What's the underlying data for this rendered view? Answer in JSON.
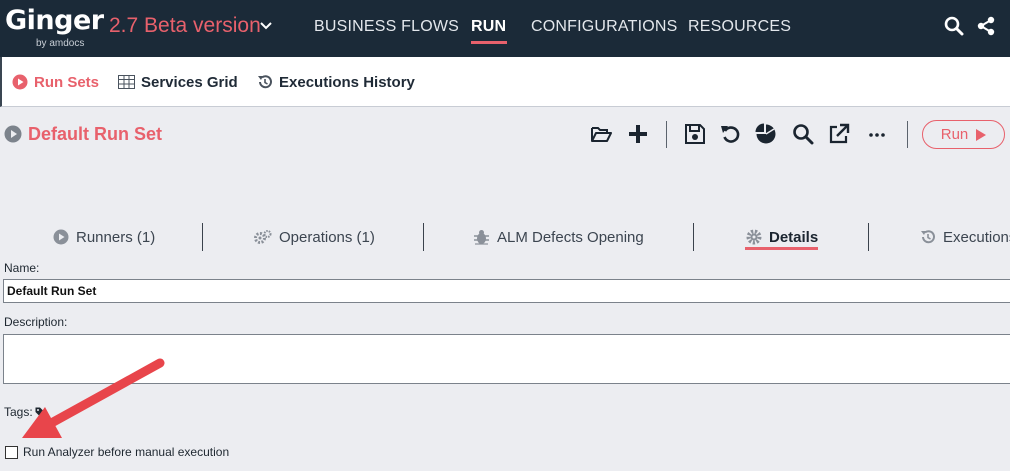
{
  "header": {
    "logo_text": "Ginger",
    "logo_sub": "by amdocs",
    "version": "2.7 Beta version",
    "nav": [
      {
        "label": "BUSINESS FLOWS",
        "active": false
      },
      {
        "label": "RUN",
        "active": true
      },
      {
        "label": "CONFIGURATIONS",
        "active": false
      },
      {
        "label": "RESOURCES",
        "active": false
      }
    ],
    "icons": [
      "search-icon",
      "share-icon"
    ]
  },
  "subnav": {
    "items": [
      {
        "label": "Run Sets",
        "icon": "play-circle-icon",
        "active": true
      },
      {
        "label": "Services Grid",
        "icon": "grid-icon",
        "active": false
      },
      {
        "label": "Executions History",
        "icon": "history-icon",
        "active": false
      }
    ]
  },
  "runset": {
    "title": "Default Run Set",
    "toolbar_icons": [
      "folder-open-icon",
      "plus-icon",
      "save-icon",
      "undo-icon",
      "pie-chart-icon",
      "search-icon",
      "external-link-icon",
      "more-icon"
    ],
    "run_label": "Run"
  },
  "tabs": [
    {
      "label": "Runners (1)",
      "icon": "play-circle-icon",
      "active": false
    },
    {
      "label": "Operations (1)",
      "icon": "gears-icon",
      "active": false
    },
    {
      "label": "ALM Defects Opening",
      "icon": "bug-icon",
      "active": false
    },
    {
      "label": "Details",
      "icon": "gear-icon",
      "active": true
    },
    {
      "label": "Executions",
      "icon": "history-icon",
      "active": false
    }
  ],
  "form": {
    "name_label": "Name:",
    "name_value": "Default Run Set",
    "description_label": "Description:",
    "description_value": "",
    "tags_label": "Tags:",
    "run_analyzer_label": "Run Analyzer before manual execution",
    "run_analyzer_checked": false
  },
  "colors": {
    "accent": "#e8616c",
    "header_bg": "#1b2a38",
    "page_bg": "#ecedf1",
    "arrow": "#e8454b"
  }
}
